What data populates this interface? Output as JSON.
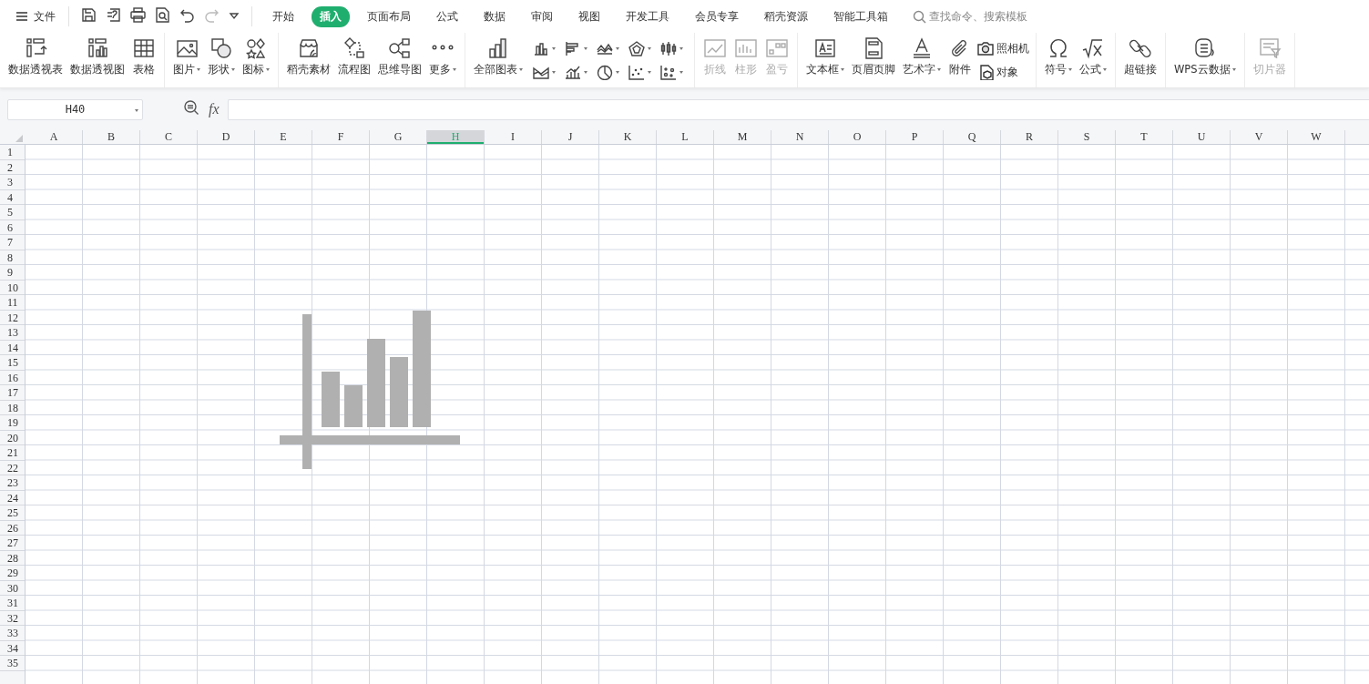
{
  "menu_bar": {
    "file_menu": "文件",
    "tabs": [
      {
        "label": "开始",
        "selected": false
      },
      {
        "label": "插入",
        "selected": true
      },
      {
        "label": "页面布局",
        "selected": false
      },
      {
        "label": "公式",
        "selected": false
      },
      {
        "label": "数据",
        "selected": false
      },
      {
        "label": "审阅",
        "selected": false
      },
      {
        "label": "视图",
        "selected": false
      },
      {
        "label": "开发工具",
        "selected": false
      },
      {
        "label": "会员专享",
        "selected": false
      },
      {
        "label": "稻壳资源",
        "selected": false
      },
      {
        "label": "智能工具箱",
        "selected": false
      }
    ],
    "search": {
      "placeholder": "查找命令、搜索模板"
    }
  },
  "ribbon": {
    "groups": [
      {
        "items": [
          {
            "kind": "big",
            "label": "数据透视表",
            "dropdown": false,
            "disabled": false
          },
          {
            "kind": "big",
            "label": "数据透视图",
            "dropdown": false,
            "disabled": false
          },
          {
            "kind": "big",
            "label": "表格",
            "dropdown": false,
            "disabled": false
          }
        ]
      },
      {
        "items": [
          {
            "kind": "big",
            "label": "图片",
            "dropdown": true,
            "disabled": false
          },
          {
            "kind": "big",
            "label": "形状",
            "dropdown": true,
            "disabled": false
          },
          {
            "kind": "big",
            "label": "图标",
            "dropdown": true,
            "disabled": false
          }
        ]
      },
      {
        "items": [
          {
            "kind": "big",
            "label": "稻壳素材",
            "dropdown": false,
            "disabled": false
          },
          {
            "kind": "big",
            "label": "流程图",
            "dropdown": false,
            "disabled": false
          },
          {
            "kind": "big",
            "label": "思维导图",
            "dropdown": false,
            "disabled": false
          },
          {
            "kind": "big",
            "label": "更多",
            "dropdown": true,
            "disabled": false
          }
        ]
      },
      {
        "items": [
          {
            "kind": "big",
            "label": "全部图表",
            "dropdown": true,
            "disabled": false
          },
          {
            "kind": "chart-grid",
            "buttons": [
              {
                "dropdown": true
              },
              {
                "dropdown": true
              },
              {
                "dropdown": true
              },
              {
                "dropdown": true
              },
              {
                "dropdown": true
              },
              {
                "dropdown": true
              },
              {
                "dropdown": true
              },
              {
                "dropdown": true
              },
              {
                "dropdown": true
              },
              {
                "dropdown": true
              }
            ]
          }
        ]
      },
      {
        "items": [
          {
            "kind": "big",
            "label": "折线",
            "dropdown": false,
            "disabled": true
          },
          {
            "kind": "big",
            "label": "柱形",
            "dropdown": false,
            "disabled": true
          },
          {
            "kind": "big",
            "label": "盈亏",
            "dropdown": false,
            "disabled": true
          }
        ]
      },
      {
        "items": [
          {
            "kind": "big",
            "label": "文本框",
            "dropdown": true,
            "disabled": false
          },
          {
            "kind": "big",
            "label": "页眉页脚",
            "dropdown": false,
            "disabled": false
          },
          {
            "kind": "big",
            "label": "艺术字",
            "dropdown": true,
            "disabled": false
          },
          {
            "kind": "big",
            "label": "附件",
            "dropdown": false,
            "disabled": false
          },
          {
            "kind": "small-stack",
            "items": [
              {
                "label": "照相机"
              },
              {
                "label": "对象"
              }
            ]
          }
        ]
      },
      {
        "items": [
          {
            "kind": "big",
            "label": "符号",
            "dropdown": true,
            "disabled": false
          },
          {
            "kind": "big",
            "label": "公式",
            "dropdown": true,
            "disabled": false
          }
        ]
      },
      {
        "items": [
          {
            "kind": "big",
            "label": "超链接",
            "dropdown": false,
            "disabled": false
          }
        ]
      },
      {
        "items": [
          {
            "kind": "big",
            "label": "WPS云数据",
            "dropdown": true,
            "disabled": false
          }
        ]
      },
      {
        "items": [
          {
            "kind": "big",
            "label": "切片器",
            "dropdown": false,
            "disabled": true
          }
        ]
      }
    ]
  },
  "formula_bar": {
    "name_box": "H40",
    "function_label": "fx"
  },
  "sheet": {
    "columns": [
      {
        "label": "A",
        "selected": false
      },
      {
        "label": "B",
        "selected": false
      },
      {
        "label": "C",
        "selected": false
      },
      {
        "label": "D",
        "selected": false
      },
      {
        "label": "E",
        "selected": false
      },
      {
        "label": "F",
        "selected": false
      },
      {
        "label": "G",
        "selected": false
      },
      {
        "label": "H",
        "selected": true
      },
      {
        "label": "I",
        "selected": false
      },
      {
        "label": "J",
        "selected": false
      },
      {
        "label": "K",
        "selected": false
      },
      {
        "label": "L",
        "selected": false
      },
      {
        "label": "M",
        "selected": false
      },
      {
        "label": "N",
        "selected": false
      },
      {
        "label": "O",
        "selected": false
      },
      {
        "label": "P",
        "selected": false
      },
      {
        "label": "Q",
        "selected": false
      },
      {
        "label": "R",
        "selected": false
      },
      {
        "label": "S",
        "selected": false
      },
      {
        "label": "T",
        "selected": false
      },
      {
        "label": "U",
        "selected": false
      },
      {
        "label": "V",
        "selected": false
      },
      {
        "label": "W",
        "selected": false
      }
    ],
    "rows": [
      "1",
      "2",
      "3",
      "4",
      "5",
      "6",
      "7",
      "8",
      "9",
      "10",
      "11",
      "12",
      "13",
      "14",
      "15",
      "16",
      "17",
      "18",
      "19",
      "20",
      "21",
      "22",
      "23",
      "24",
      "25",
      "26",
      "27",
      "28",
      "29",
      "30",
      "31",
      "32",
      "33",
      "34",
      "35"
    ]
  }
}
